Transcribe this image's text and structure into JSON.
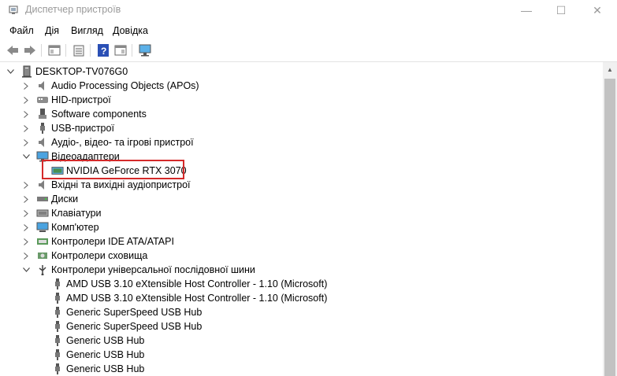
{
  "window": {
    "title": "Диспетчер пристроїв",
    "minimize": "—",
    "maximize": "☐",
    "close": "✕"
  },
  "menu": [
    "Файл",
    "Дія",
    "Вигляд",
    "Довідка"
  ],
  "tree": {
    "root": "DESKTOP-TV076G0",
    "items": [
      {
        "label": "Audio Processing Objects (APOs)",
        "icon": "speaker-icon",
        "expanded": false
      },
      {
        "label": "HID-пристрої",
        "icon": "hid-icon",
        "expanded": false
      },
      {
        "label": "Software components",
        "icon": "software-component-icon",
        "expanded": false
      },
      {
        "label": "USB-пристрої",
        "icon": "usb-plug-icon",
        "expanded": false
      },
      {
        "label": "Аудіо-, відео- та ігрові пристрої",
        "icon": "speaker-icon",
        "expanded": false
      },
      {
        "label": "Відеоадаптери",
        "icon": "monitor-icon",
        "expanded": true
      },
      {
        "label": "NVIDIA GeForce RTX 3070",
        "icon": "display-adapter-icon",
        "child": true,
        "highlighted": true
      },
      {
        "label": "Вхідні та вихідні аудіопристрої",
        "icon": "speaker-icon",
        "expanded": false
      },
      {
        "label": "Диски",
        "icon": "disk-drive-icon",
        "expanded": false
      },
      {
        "label": "Клавіатури",
        "icon": "keyboard-icon",
        "expanded": false
      },
      {
        "label": "Комп'ютер",
        "icon": "computer-icon",
        "expanded": false
      },
      {
        "label": "Контролери IDE ATA/ATAPI",
        "icon": "ide-controller-icon",
        "expanded": false
      },
      {
        "label": "Контролери сховища",
        "icon": "storage-controller-icon",
        "expanded": false
      },
      {
        "label": "Контролери універсальної послідовної шини",
        "icon": "usb-controller-icon",
        "expanded": true
      },
      {
        "label": "AMD USB 3.10 eXtensible Host Controller - 1.10 (Microsoft)",
        "icon": "usb-plug-icon",
        "child": true
      },
      {
        "label": "AMD USB 3.10 eXtensible Host Controller - 1.10 (Microsoft)",
        "icon": "usb-plug-icon",
        "child": true
      },
      {
        "label": "Generic SuperSpeed USB Hub",
        "icon": "usb-plug-icon",
        "child": true
      },
      {
        "label": "Generic SuperSpeed USB Hub",
        "icon": "usb-plug-icon",
        "child": true
      },
      {
        "label": "Generic USB Hub",
        "icon": "usb-plug-icon",
        "child": true
      },
      {
        "label": "Generic USB Hub",
        "icon": "usb-plug-icon",
        "child": true
      },
      {
        "label": "Generic USB Hub",
        "icon": "usb-plug-icon",
        "child": true
      }
    ]
  },
  "colors": {
    "highlight_border": "#d42a2a",
    "accent_blue": "#1e73c8",
    "title_gray": "#9a9a9a"
  }
}
